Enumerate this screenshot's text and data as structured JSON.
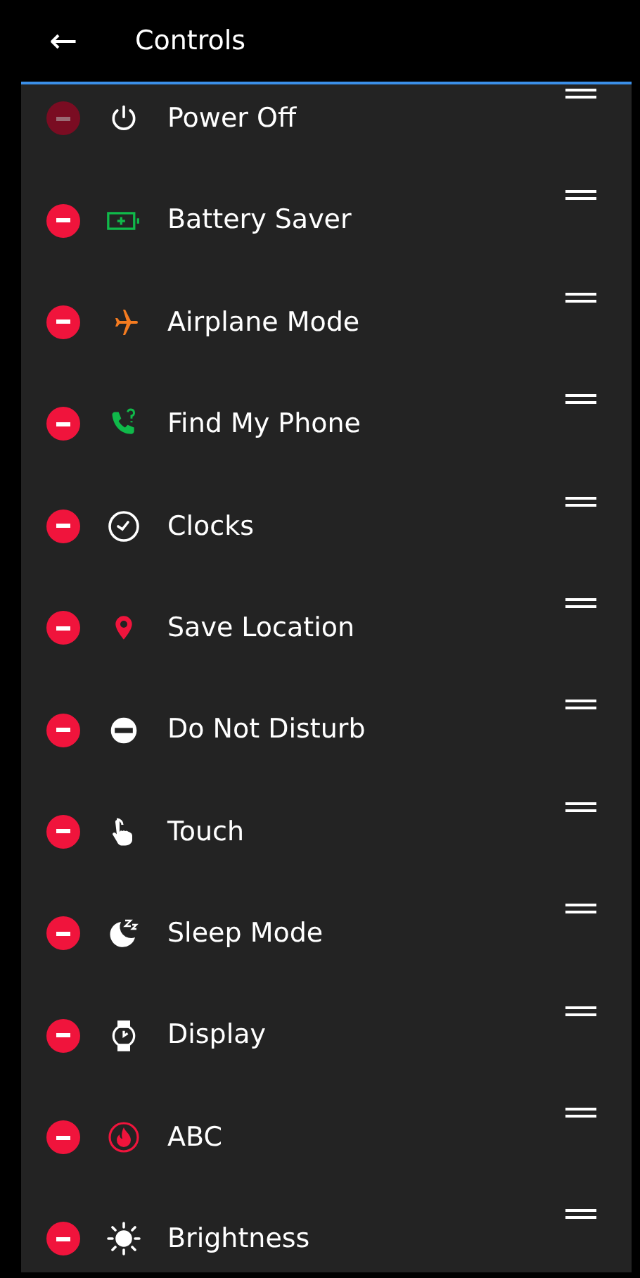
{
  "header": {
    "back": "←",
    "title": "Controls"
  },
  "items": [
    {
      "label": "Power Off",
      "kind": "power",
      "disabled": true
    },
    {
      "label": "Battery Saver",
      "kind": "battery",
      "disabled": false
    },
    {
      "label": "Airplane Mode",
      "kind": "airplane",
      "disabled": false
    },
    {
      "label": "Find My Phone",
      "kind": "phone",
      "disabled": false
    },
    {
      "label": "Clocks",
      "kind": "clock",
      "disabled": false
    },
    {
      "label": "Save Location",
      "kind": "pin",
      "disabled": false
    },
    {
      "label": "Do Not Disturb",
      "kind": "dnd",
      "disabled": false
    },
    {
      "label": "Touch",
      "kind": "touch",
      "disabled": false
    },
    {
      "label": "Sleep Mode",
      "kind": "sleep",
      "disabled": false
    },
    {
      "label": "Display",
      "kind": "watch",
      "disabled": false
    },
    {
      "label": "ABC",
      "kind": "flame",
      "disabled": false
    },
    {
      "label": "Brightness",
      "kind": "sun",
      "disabled": false
    }
  ]
}
